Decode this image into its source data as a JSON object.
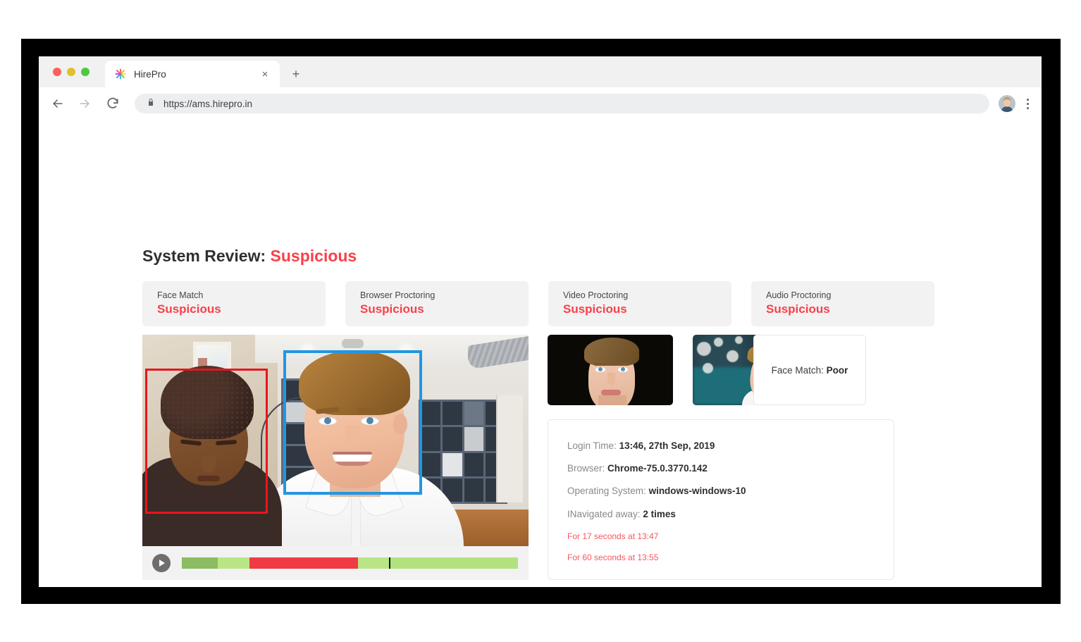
{
  "browser": {
    "tab": {
      "title": "HirePro",
      "favicon_icon": "hirepro-starburst-icon",
      "close_icon": "×",
      "newtab_icon": "+"
    },
    "nav": {
      "back_icon": "←",
      "forward_icon": "→",
      "reload_icon": "⟳"
    },
    "omnibox": {
      "lock_icon": "lock-icon",
      "url": "https://ams.hirepro.in"
    },
    "profile": {
      "avatar_icon": "user-avatar"
    },
    "menu": {
      "kebab_icon": "three-dot-vertical"
    },
    "traffic_lights": [
      "close",
      "minimize",
      "maximize"
    ]
  },
  "page": {
    "title_prefix": "System Review:",
    "title_status": "Suspicious",
    "accent_red": "#f8404a",
    "cards": [
      {
        "label": "Face Match",
        "status": "Suspicious"
      },
      {
        "label": "Browser Proctoring",
        "status": "Suspicious"
      },
      {
        "label": "Video Proctoring",
        "status": "Suspicious"
      },
      {
        "label": "Audio Proctoring",
        "status": "Suspicious"
      }
    ],
    "video": {
      "detections": [
        {
          "name": "unidentified-person",
          "color": "#e8151f"
        },
        {
          "name": "candidate",
          "color": "#2196e3"
        }
      ],
      "player": {
        "play_icon": "play-triangle",
        "timeline_segments": [
          {
            "color": "#8cbc62",
            "width_pct": 10.6
          },
          {
            "color": "#b9e585",
            "width_pct": 9.5
          },
          {
            "color": "#ef3b44",
            "width_pct": 32.3
          },
          {
            "color": "#b9e585",
            "width_pct": 9.3
          },
          {
            "color": "#b2e27e",
            "width_pct": 38.3
          }
        ],
        "marker_position_pct": 61.7
      }
    },
    "face_match": {
      "label": "Face Match:",
      "value": "Poor"
    },
    "info": {
      "rows": [
        {
          "label": "Login Time:",
          "value": "13:46, 27th Sep, 2019"
        },
        {
          "label": "Browser:",
          "value": "Chrome-75.0.3770.142"
        },
        {
          "label": "Operating System:",
          "value": "windows-windows-10"
        },
        {
          "label": "INavigated away:",
          "value": "2 times"
        }
      ],
      "alerts": [
        "For 17 seconds at 13:47",
        "For 60 seconds at 13:55"
      ]
    }
  }
}
